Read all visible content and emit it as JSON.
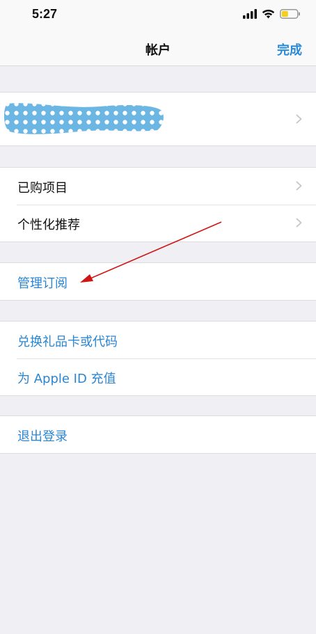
{
  "status_bar": {
    "time": "5:27",
    "icons": [
      "signal-icon",
      "wifi-icon",
      "battery-icon"
    ],
    "battery_color": "#f5cf1f"
  },
  "nav": {
    "title": "帐户",
    "done_label": "完成"
  },
  "profile": {
    "icon": "chevron-right-icon"
  },
  "group1": {
    "items": [
      {
        "label": "已购项目"
      },
      {
        "label": "个性化推荐"
      }
    ]
  },
  "group2": {
    "items": [
      {
        "label": "管理订阅"
      }
    ]
  },
  "group3": {
    "items": [
      {
        "label": "兑换礼品卡或代码"
      },
      {
        "label": "为 Apple ID 充值"
      }
    ]
  },
  "group4": {
    "items": [
      {
        "label": "退出登录"
      }
    ]
  },
  "colors": {
    "accent": "#2a86d3",
    "annotation_arrow": "#d01515",
    "background": "#efeff4"
  }
}
